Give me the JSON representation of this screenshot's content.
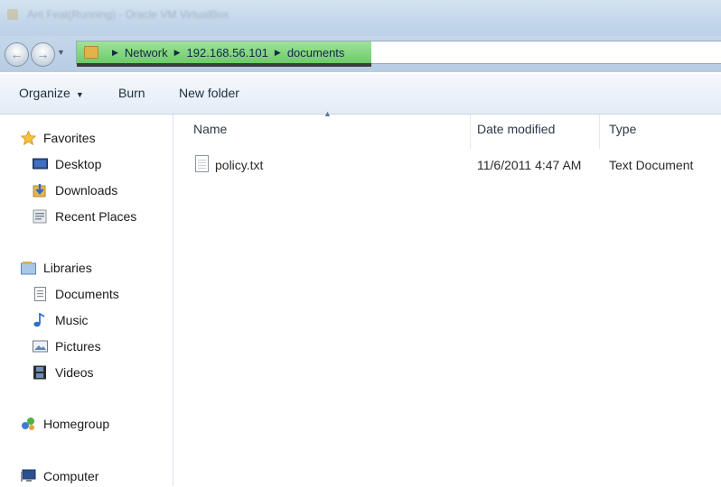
{
  "window": {
    "title": "Ant Feat(Running) - Oracle VM VirtualBox"
  },
  "address": {
    "crumbs": [
      "Network",
      "192.168.56.101",
      "documents"
    ]
  },
  "commandbar": {
    "organize": "Organize",
    "burn": "Burn",
    "new_folder": "New folder"
  },
  "sidebar": {
    "favorites": "Favorites",
    "desktop": "Desktop",
    "downloads": "Downloads",
    "recent_places": "Recent Places",
    "libraries": "Libraries",
    "documents": "Documents",
    "music": "Music",
    "pictures": "Pictures",
    "videos": "Videos",
    "homegroup": "Homegroup",
    "computer": "Computer"
  },
  "table": {
    "columns": [
      "Name",
      "Date modified",
      "Type"
    ],
    "rows": [
      {
        "name": "policy.txt",
        "date": "11/6/2011 4:47 AM",
        "type": "Text Document"
      }
    ]
  },
  "icons": {
    "back": "back-arrow-icon",
    "forward": "forward-arrow-icon",
    "folder": "folder-icon",
    "file": "text-file-icon"
  }
}
